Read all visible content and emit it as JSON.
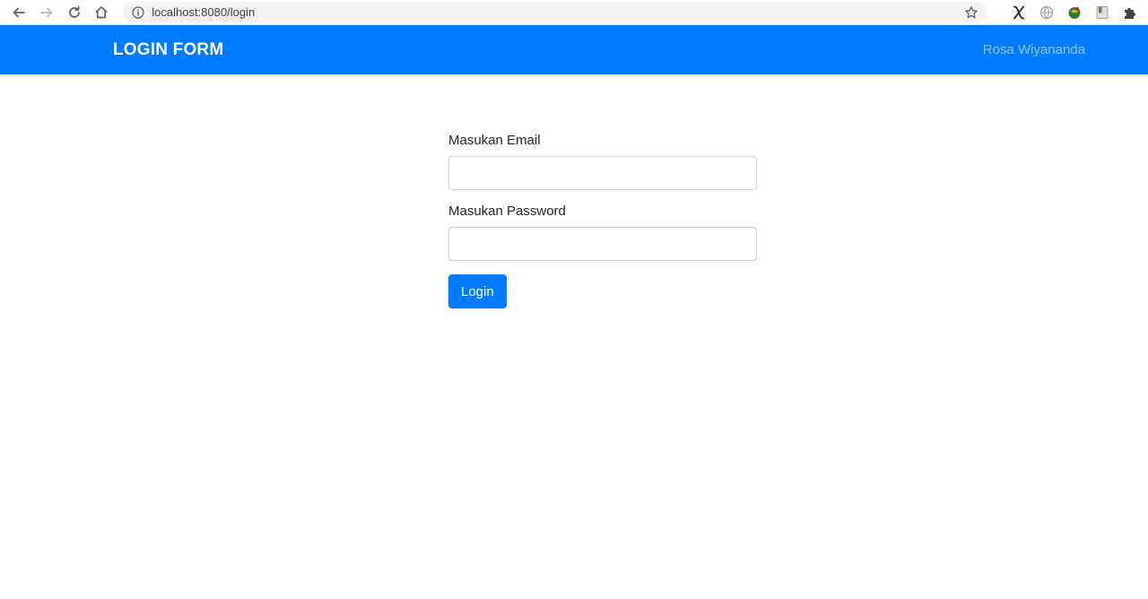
{
  "browser": {
    "url": "localhost:8080/login",
    "icons": {
      "back": "arrow-left-icon",
      "forward": "arrow-right-icon",
      "reload": "reload-icon",
      "home": "home-icon",
      "info": "info-icon",
      "bookmark": "star-icon",
      "extensions": [
        "x-extension-icon",
        "globe-extension-icon",
        "green-extension-icon",
        "bookmark-extension-icon",
        "puzzle-icon"
      ]
    }
  },
  "navbar": {
    "brand": "LOGIN FORM",
    "user": "Rosa Wiyananda",
    "color": "#007bff"
  },
  "form": {
    "email_label": "Masukan Email",
    "email_value": "",
    "password_label": "Masukan Password",
    "password_value": "",
    "submit_label": "Login"
  }
}
